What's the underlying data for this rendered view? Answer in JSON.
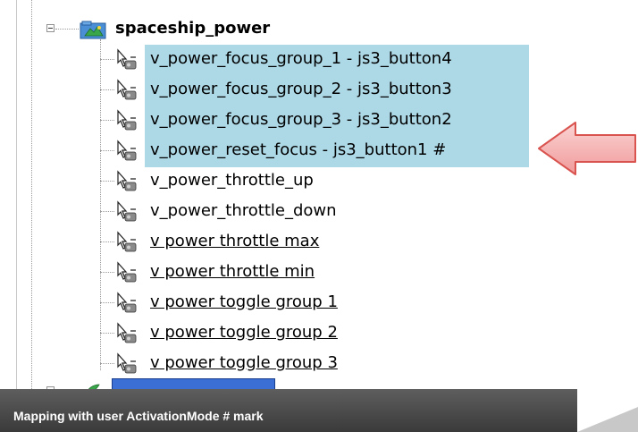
{
  "tree": {
    "root": {
      "label": "spaceship_power",
      "icon": "map-folder-icon"
    },
    "items": [
      {
        "label": "v_power_focus_group_1 - js3_button4",
        "selected": true
      },
      {
        "label": "v_power_focus_group_2 - js3_button3",
        "selected": true
      },
      {
        "label": "v_power_focus_group_3 - js3_button2",
        "selected": true
      },
      {
        "label": "v_power_reset_focus - js3_button1 #",
        "selected": true
      },
      {
        "label": "v_power_throttle_up",
        "selected": false
      },
      {
        "label": "v_power_throttle_down",
        "selected": false
      },
      {
        "label": "v power throttle max",
        "selected": false,
        "underlined": true
      },
      {
        "label": "v power throttle min",
        "selected": false,
        "underlined": true
      },
      {
        "label": "v power toggle group 1",
        "selected": false,
        "underlined": true
      },
      {
        "label": "v power toggle group 2",
        "selected": false,
        "underlined": true
      },
      {
        "label": "v power toggle group 3",
        "selected": false,
        "underlined": true
      }
    ],
    "item_icon": "action-pointer-icon",
    "selection_color": "#add8e6"
  },
  "annotation": {
    "arrow_color": "#f4a6a6",
    "arrow_border": "#d9534f"
  },
  "caption": {
    "text": "Mapping with user ActivationMode  # mark"
  }
}
